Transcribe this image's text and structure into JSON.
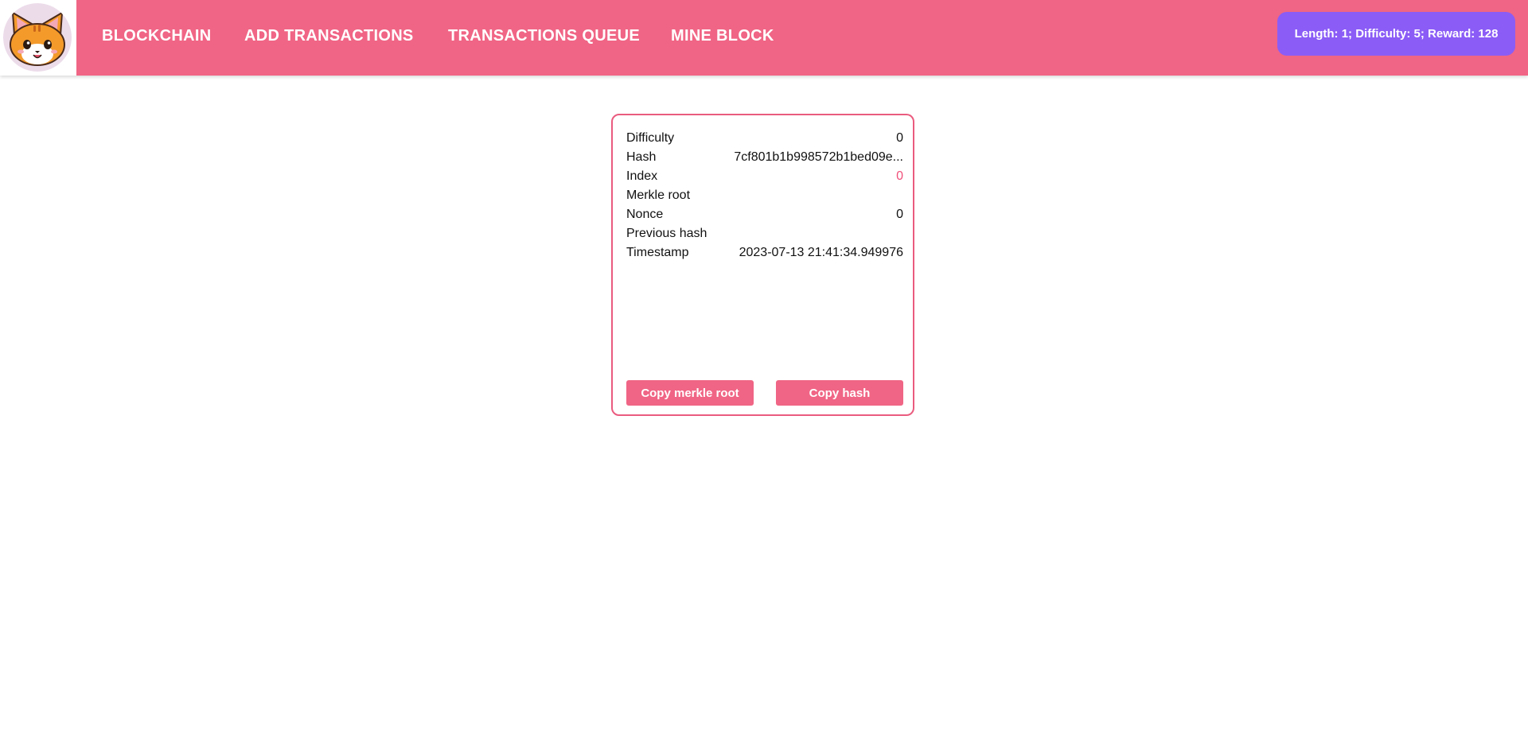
{
  "nav": {
    "items": [
      "BLOCKCHAIN",
      "ADD TRANSACTIONS",
      "TRANSACTIONS QUEUE",
      "MINE BLOCK"
    ],
    "stats": "Length: 1; Difficulty: 5; Reward: 128"
  },
  "logo": {
    "icon": "cat-face-icon"
  },
  "block": {
    "rows": [
      {
        "label": "Difficulty",
        "value": "0"
      },
      {
        "label": "Hash",
        "value": "7cf801b1b998572b1bed09e..."
      },
      {
        "label": "Index",
        "value": "0"
      },
      {
        "label": "Merkle root",
        "value": ""
      },
      {
        "label": "Nonce",
        "value": "0"
      },
      {
        "label": "Previous hash",
        "value": ""
      },
      {
        "label": "Timestamp",
        "value": "2023-07-13 21:41:34.949976"
      }
    ],
    "buttons": {
      "copy_merkle": "Copy merkle root",
      "copy_hash": "Copy hash"
    }
  },
  "colors": {
    "navbar": "#f06585",
    "badge": "#8b5cf6",
    "card_border": "#ea5b7f",
    "index_accent": "#f0507a"
  }
}
